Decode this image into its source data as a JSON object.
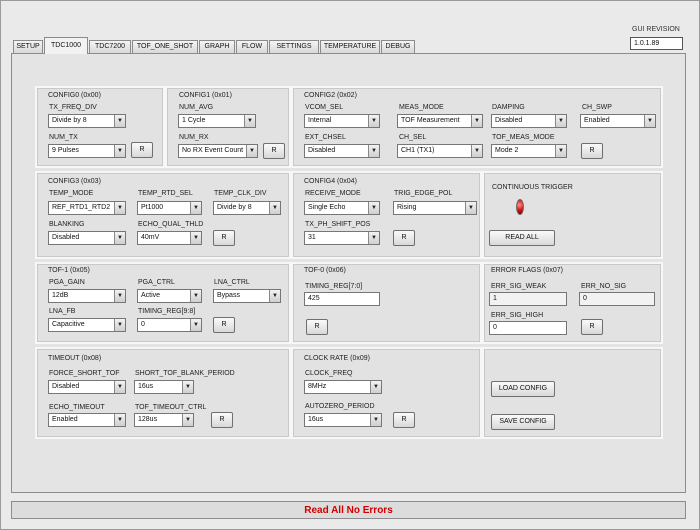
{
  "gui_revision": {
    "label": "GUI REVISION",
    "value": "1.0.1.89"
  },
  "tabs": [
    "SETUP",
    "TDC1000",
    "TDC7200",
    "TOF_ONE_SHOT",
    "GRAPH",
    "FLOW",
    "SETTINGS",
    "TEMPERATURE",
    "DEBUG"
  ],
  "active_tab": "TDC1000",
  "config0": {
    "title": "CONFIG0 (0x00)",
    "tx_freq_div": {
      "label": "TX_FREQ_DIV",
      "value": "Divide by 8"
    },
    "num_tx": {
      "label": "NUM_TX",
      "value": "9 Pulses"
    },
    "button": "R"
  },
  "config1": {
    "title": "CONFIG1 (0x01)",
    "num_avg": {
      "label": "NUM_AVG",
      "value": "1 Cycle"
    },
    "num_rx": {
      "label": "NUM_RX",
      "value": "No RX Event Count"
    },
    "button": "R"
  },
  "config2": {
    "title": "CONFIG2 (0x02)",
    "vcom_sel": {
      "label": "VCOM_SEL",
      "value": "Internal"
    },
    "meas_mode": {
      "label": "MEAS_MODE",
      "value": "TOF Measurement"
    },
    "damping": {
      "label": "DAMPING",
      "value": "Disabled"
    },
    "ch_swp": {
      "label": "CH_SWP",
      "value": "Enabled"
    },
    "ext_chsel": {
      "label": "EXT_CHSEL",
      "value": "Disabled"
    },
    "ch_sel": {
      "label": "CH_SEL",
      "value": "CH1 (TX1)"
    },
    "tof_meas_mode": {
      "label": "TOF_MEAS_MODE",
      "value": "Mode 2"
    },
    "button": "R"
  },
  "config3": {
    "title": "CONFIG3 (0x03)",
    "temp_mode": {
      "label": "TEMP_MODE",
      "value": "REF_RTD1_RTD2"
    },
    "temp_rtd_sel": {
      "label": "TEMP_RTD_SEL",
      "value": "Pt1000"
    },
    "temp_clk_div": {
      "label": "TEMP_CLK_DIV",
      "value": "Divide by 8"
    },
    "blanking": {
      "label": "BLANKING",
      "value": "Disabled"
    },
    "echo_qual_thld": {
      "label": "ECHO_QUAL_THLD",
      "value": "40mV"
    },
    "button": "R"
  },
  "config4": {
    "title": "CONFIG4 (0x04)",
    "receive_mode": {
      "label": "RECEIVE_MODE",
      "value": "Single Echo"
    },
    "trig_edge_pol": {
      "label": "TRIG_EDGE_POL",
      "value": "Rising"
    },
    "tx_ph_shift_pos": {
      "label": "TX_PH_SHIFT_POS",
      "value": "31"
    },
    "button": "R"
  },
  "trigger": {
    "label": "CONTINUOUS TRIGGER",
    "read_all": "READ ALL",
    "led_color": "#d01010"
  },
  "tof1": {
    "title": "TOF-1 (0x05)",
    "pga_gain": {
      "label": "PGA_GAIN",
      "value": "12dB"
    },
    "pga_ctrl": {
      "label": "PGA_CTRL",
      "value": "Active"
    },
    "lna_ctrl": {
      "label": "LNA_CTRL",
      "value": "Bypass"
    },
    "lna_fb": {
      "label": "LNA_FB",
      "value": "Capacitive"
    },
    "timing_reg_98": {
      "label": "TIMING_REG[9:8]",
      "value": "0"
    },
    "button": "R"
  },
  "tof0": {
    "title": "TOF-0 (0x06)",
    "timing_reg_70": {
      "label": "TIMING_REG[7:0]",
      "value": "425"
    },
    "button": "R"
  },
  "error_flags": {
    "title": "ERROR FLAGS (0x07)",
    "err_sig_weak": {
      "label": "ERR_SIG_WEAK",
      "value": "1"
    },
    "err_no_sig": {
      "label": "ERR_NO_SIG",
      "value": "0"
    },
    "err_sig_high": {
      "label": "ERR_SIG_HIGH",
      "value": "0"
    },
    "button": "R"
  },
  "timeout": {
    "title": "TIMEOUT (0x08)",
    "force_short_tof": {
      "label": "FORCE_SHORT_TOF",
      "value": "Disabled"
    },
    "short_tof_blank_period": {
      "label": "SHORT_TOF_BLANK_PERIOD",
      "value": "16us"
    },
    "echo_timeout": {
      "label": "ECHO_TIMEOUT",
      "value": "Enabled"
    },
    "tof_timeout_ctrl": {
      "label": "TOF_TIMEOUT_CTRL",
      "value": "128us"
    },
    "button": "R"
  },
  "clock_rate": {
    "title": "CLOCK RATE (0x09)",
    "clock_freq": {
      "label": "CLOCK_FREQ",
      "value": "8MHz"
    },
    "autozero_period": {
      "label": "AUTOZERO_PERIOD",
      "value": "16us"
    },
    "button": "R"
  },
  "config_buttons": {
    "load": "LOAD CONFIG",
    "save": "SAVE CONFIG"
  },
  "status": {
    "text": "Read All No Errors",
    "color": "#d00000"
  },
  "icons": {
    "dropdown": "chevron-down-icon",
    "led": "status-led-icon"
  }
}
